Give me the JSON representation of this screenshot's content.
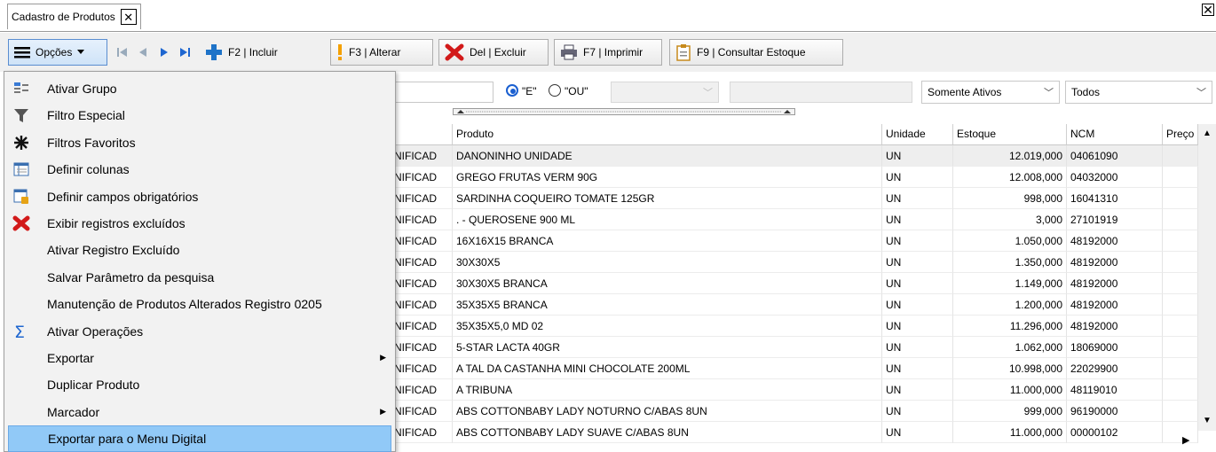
{
  "tab": {
    "title": "Cadastro de Produtos",
    "close": "✕"
  },
  "window": {
    "close": "✕"
  },
  "toolbar": {
    "opcoes": "Opções",
    "incluir": "F2 | Incluir",
    "alterar": "F3 | Alterar",
    "excluir": "Del | Excluir",
    "imprimir": "F7 | Imprimir",
    "consultar": "F9 | Consultar Estoque"
  },
  "filter": {
    "radio_e": "\"E\"",
    "radio_ou": "\"OU\"",
    "status": "Somente Ativos",
    "scope": "Todos"
  },
  "grid": {
    "headers": [
      "Produto",
      "Unidade",
      "Estoque",
      "NCM",
      "Preço"
    ],
    "rows": [
      {
        "pre": "NIFICAD",
        "produto": "DANONINHO UNIDADE",
        "unidade": "UN",
        "estoque": "12.019,000",
        "ncm": "04061090"
      },
      {
        "pre": "NIFICAD",
        "produto": "GREGO FRUTAS VERM 90G",
        "unidade": "UN",
        "estoque": "12.008,000",
        "ncm": "04032000"
      },
      {
        "pre": "NIFICAD",
        "produto": "SARDINHA COQUEIRO TOMATE 125GR",
        "unidade": "UN",
        "estoque": "998,000",
        "ncm": "16041310"
      },
      {
        "pre": "NIFICAD",
        "produto": ". - QUEROSENE 900 ML",
        "unidade": "UN",
        "estoque": "3,000",
        "ncm": "27101919"
      },
      {
        "pre": "NIFICAD",
        "produto": "16X16X15 BRANCA",
        "unidade": "UN",
        "estoque": "1.050,000",
        "ncm": "48192000"
      },
      {
        "pre": "NIFICAD",
        "produto": "30X30X5",
        "unidade": "UN",
        "estoque": "1.350,000",
        "ncm": "48192000"
      },
      {
        "pre": "NIFICAD",
        "produto": "30X30X5 BRANCA",
        "unidade": "UN",
        "estoque": "1.149,000",
        "ncm": "48192000"
      },
      {
        "pre": "NIFICAD",
        "produto": "35X35X5 BRANCA",
        "unidade": "UN",
        "estoque": "1.200,000",
        "ncm": "48192000"
      },
      {
        "pre": "NIFICAD",
        "produto": "35X35X5,0 MD 02",
        "unidade": "UN",
        "estoque": "11.296,000",
        "ncm": "48192000"
      },
      {
        "pre": "NIFICAD",
        "produto": "5-STAR LACTA 40GR",
        "unidade": "UN",
        "estoque": "1.062,000",
        "ncm": "18069000"
      },
      {
        "pre": "NIFICAD",
        "produto": "A TAL DA CASTANHA MINI CHOCOLATE 200ML",
        "unidade": "UN",
        "estoque": "10.998,000",
        "ncm": "22029900"
      },
      {
        "pre": "NIFICAD",
        "produto": "A TRIBUNA",
        "unidade": "UN",
        "estoque": "11.000,000",
        "ncm": "48119010"
      },
      {
        "pre": "NIFICAD",
        "produto": "ABS COTTONBABY LADY NOTURNO C/ABAS 8UN",
        "unidade": "UN",
        "estoque": "999,000",
        "ncm": "96190000"
      },
      {
        "pre": "NIFICAD",
        "produto": "ABS COTTONBABY LADY SUAVE C/ABAS 8UN",
        "unidade": "UN",
        "estoque": "11.000,000",
        "ncm": "00000102"
      }
    ]
  },
  "menu": {
    "items": [
      {
        "label": "Ativar Grupo",
        "icon": "group-icon"
      },
      {
        "label": "Filtro Especial",
        "icon": "funnel-icon"
      },
      {
        "label": "Filtros Favoritos",
        "icon": "star-burst-icon"
      },
      {
        "label": "Definir colunas",
        "icon": "columns-icon"
      },
      {
        "label": "Definir campos obrigatórios",
        "icon": "required-fields-icon"
      },
      {
        "label": "Exibir registros excluídos",
        "icon": "red-x-icon"
      },
      {
        "label": "Ativar Registro Excluído",
        "icon": ""
      },
      {
        "label": "Salvar Parâmetro da pesquisa",
        "icon": ""
      },
      {
        "label": "Manutenção de Produtos Alterados Registro 0205",
        "icon": ""
      },
      {
        "label": "Ativar Operações",
        "icon": "sigma-icon"
      },
      {
        "label": "Exportar",
        "icon": "",
        "submenu": true
      },
      {
        "label": "Duplicar Produto",
        "icon": ""
      },
      {
        "label": "Marcador",
        "icon": "",
        "submenu": true
      },
      {
        "label": "Exportar para o Menu Digital",
        "icon": "",
        "highlighted": true
      }
    ]
  }
}
